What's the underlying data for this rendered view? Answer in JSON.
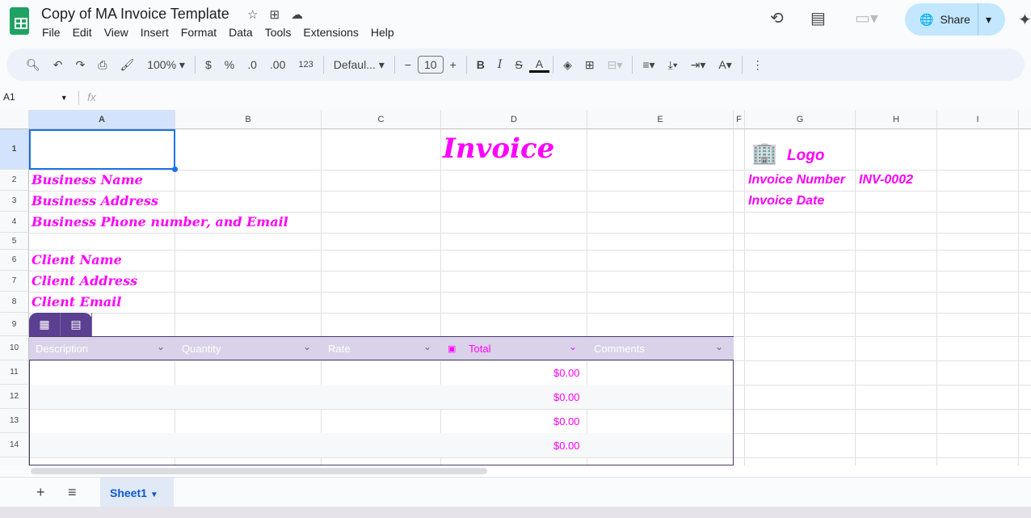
{
  "app": {
    "title": "Copy of MA Invoice Template",
    "menu": [
      "File",
      "Edit",
      "View",
      "Insert",
      "Format",
      "Data",
      "Tools",
      "Extensions",
      "Help"
    ],
    "share_label": "Share"
  },
  "toolbar": {
    "zoom": "100%",
    "currency": "$",
    "percent": "%",
    "dec_decrease": ".0",
    "dec_increase": ".00",
    "format_more": "123",
    "font": "Defaul...",
    "font_size": "10"
  },
  "formula_bar": {
    "name_box": "A1",
    "fx": "fx"
  },
  "columns": [
    "A",
    "B",
    "C",
    "D",
    "E",
    "F",
    "G",
    "H",
    "I"
  ],
  "rows": [
    "1",
    "2",
    "3",
    "4",
    "5",
    "6",
    "7",
    "8",
    "9",
    "10",
    "11",
    "12",
    "13",
    "14"
  ],
  "cells": {
    "title": "Invoice",
    "logo": "Logo",
    "business_name": "Business Name",
    "business_address": "Business Address",
    "business_contact": "Business Phone number, and Email",
    "client_name": "Client Name",
    "client_address": "Client Address",
    "client_email": "Client Email",
    "invoice_number_label": "Invoice Number",
    "invoice_number": "INV-0002",
    "invoice_date_label": "Invoice Date"
  },
  "table": {
    "headers": [
      "Description",
      "Quantity",
      "Rate",
      "Total",
      "Comments"
    ],
    "totals": [
      "$0.00",
      "$0.00",
      "$0.00",
      "$0.00"
    ]
  },
  "sheets": [
    {
      "name": "Sheet1"
    }
  ],
  "colors": {
    "accent": "#ff00ff",
    "table_header": "#d9d2e9",
    "table_border": "#4a3a6e"
  }
}
